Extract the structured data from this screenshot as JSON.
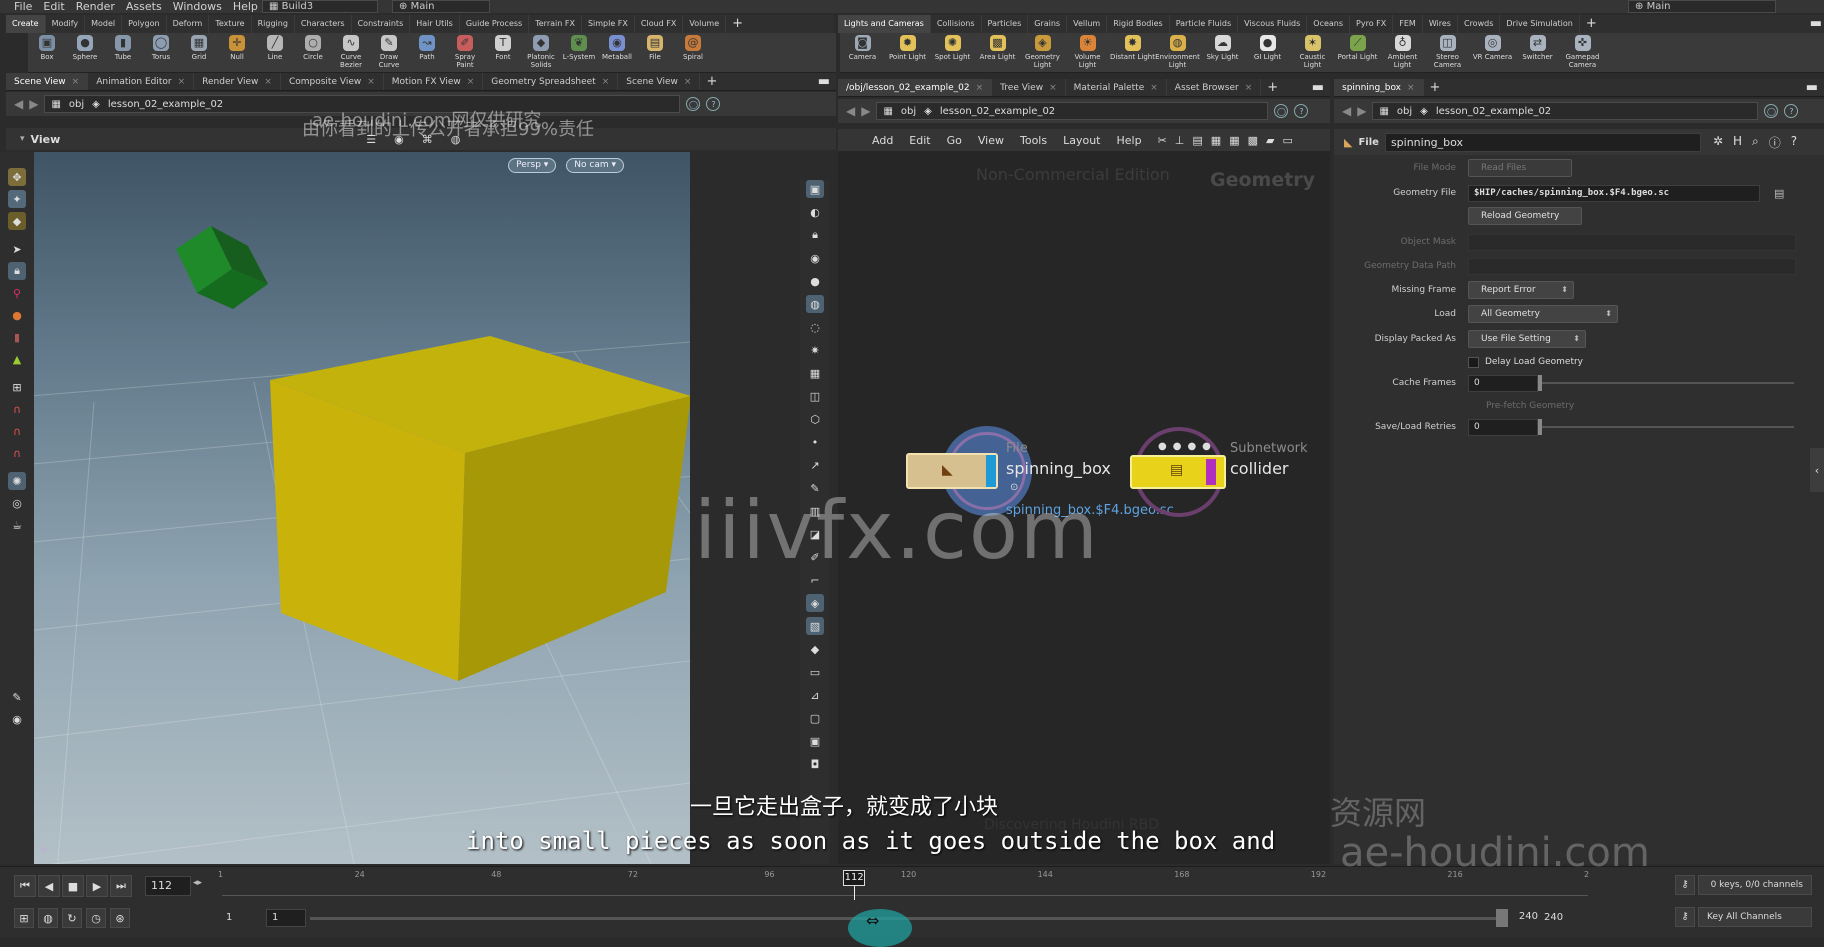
{
  "menu": [
    "File",
    "Edit",
    "Render",
    "Assets",
    "Windows",
    "Help"
  ],
  "desktop": "Build3",
  "context": "Main",
  "context_right": "Main",
  "shelf_left": {
    "tabs": [
      "Create",
      "Modify",
      "Model",
      "Polygon",
      "Deform",
      "Texture",
      "Rigging",
      "Characters",
      "Constraints",
      "Hair Utils",
      "Guide Process",
      "Terrain FX",
      "Simple FX",
      "Cloud FX",
      "Volume"
    ],
    "tools": [
      {
        "label": "Box",
        "color": "#7c8fa5",
        "glyph": "▣"
      },
      {
        "label": "Sphere",
        "color": "#95a6b8",
        "glyph": "●"
      },
      {
        "label": "Tube",
        "color": "#8797aa",
        "glyph": "▮"
      },
      {
        "label": "Torus",
        "color": "#8d9db0",
        "glyph": "◯"
      },
      {
        "label": "Grid",
        "color": "#9aa5b2",
        "glyph": "▦"
      },
      {
        "label": "Null",
        "color": "#c89238",
        "glyph": "✛"
      },
      {
        "label": "Line",
        "color": "#b7b7b7",
        "glyph": "╱"
      },
      {
        "label": "Circle",
        "color": "#adadad",
        "glyph": "○"
      },
      {
        "label": "Curve Bezier",
        "color": "#c7c7c7",
        "glyph": "∿"
      },
      {
        "label": "Draw Curve",
        "color": "#c7c7c7",
        "glyph": "✎"
      },
      {
        "label": "Path",
        "color": "#6f93c5",
        "glyph": "↝"
      },
      {
        "label": "Spray Paint",
        "color": "#c85d5d",
        "glyph": "✐"
      },
      {
        "label": "Font",
        "color": "#cfcfcf",
        "glyph": "T"
      },
      {
        "label": "Platonic Solids",
        "color": "#8f9bb0",
        "glyph": "◆"
      },
      {
        "label": "L-System",
        "color": "#5f8e4e",
        "glyph": "❦"
      },
      {
        "label": "Metaball",
        "color": "#7a8fd0",
        "glyph": "◉"
      },
      {
        "label": "File",
        "color": "#d8b56c",
        "glyph": "▤"
      },
      {
        "label": "Spiral",
        "color": "#c67a3b",
        "glyph": "@"
      }
    ]
  },
  "shelf_right": {
    "tabs": [
      "Lights and Cameras",
      "Collisions",
      "Particles",
      "Grains",
      "Vellum",
      "Rigid Bodies",
      "Particle Fluids",
      "Viscous Fluids",
      "Oceans",
      "Pyro FX",
      "FEM",
      "Wires",
      "Crowds",
      "Drive Simulation"
    ],
    "tools": [
      {
        "label": "Camera",
        "color": "#9ea9b5",
        "glyph": "◙"
      },
      {
        "label": "Point Light",
        "color": "#e2c15a",
        "glyph": "✹"
      },
      {
        "label": "Spot Light",
        "color": "#e2c15a",
        "glyph": "✺"
      },
      {
        "label": "Area Light",
        "color": "#e2c15a",
        "glyph": "▩"
      },
      {
        "label": "Geometry Light",
        "color": "#c99a3c",
        "glyph": "◈"
      },
      {
        "label": "Volume Light",
        "color": "#d98438",
        "glyph": "☀"
      },
      {
        "label": "Distant Light",
        "color": "#e2c15a",
        "glyph": "✸"
      },
      {
        "label": "Environment Light",
        "color": "#d9b04a",
        "glyph": "◍"
      },
      {
        "label": "Sky Light",
        "color": "#d8d8d8",
        "glyph": "☁"
      },
      {
        "label": "GI Light",
        "color": "#e7e7e7",
        "glyph": "●"
      },
      {
        "label": "Caustic Light",
        "color": "#d8c36a",
        "glyph": "✶"
      },
      {
        "label": "Portal Light",
        "color": "#7ba34b",
        "glyph": "⟋"
      },
      {
        "label": "Ambient Light",
        "color": "#d8d8d8",
        "glyph": "♁"
      },
      {
        "label": "Stereo Camera",
        "color": "#a9b3bf",
        "glyph": "◫"
      },
      {
        "label": "VR Camera",
        "color": "#a9b3bf",
        "glyph": "◎"
      },
      {
        "label": "Switcher",
        "color": "#a9b3bf",
        "glyph": "⇄"
      },
      {
        "label": "Gamepad Camera",
        "color": "#a9b3bf",
        "glyph": "✜"
      }
    ]
  },
  "left_pane": {
    "tabs": [
      "Scene View",
      "Animation Editor",
      "Render View",
      "Composite View",
      "Motion FX View",
      "Geometry Spreadsheet",
      "Scene View"
    ],
    "path": [
      "obj",
      "lesson_02_example_02"
    ],
    "view_label": "View",
    "persp": "Persp ▾",
    "cam": "No cam ▾"
  },
  "mid_pane": {
    "tabs": [
      "/obj/lesson_02_example_02",
      "Tree View",
      "Material Palette",
      "Asset Browser"
    ],
    "path": [
      "obj",
      "lesson_02_example_02"
    ],
    "menus": [
      "Add",
      "Edit",
      "Go",
      "View",
      "Tools",
      "Layout",
      "Help"
    ],
    "edition": "Non-Commercial Edition",
    "context_label": "Geometry",
    "nodes": [
      {
        "type": "File",
        "name": "spinning_box",
        "sub": "spinning_box.$F4.bgeo.sc"
      },
      {
        "type": "Subnetwork",
        "name": "collider"
      }
    ],
    "bg_text": "Discovering Houdini RBD"
  },
  "right_pane": {
    "tab": "spinning_box",
    "path": [
      "obj",
      "lesson_02_example_02"
    ],
    "node_label": "File",
    "node_name": "spinning_box",
    "params": [
      {
        "label": "File Mode",
        "value": "Read Files",
        "kind": "dd-dim"
      },
      {
        "label": "Geometry File",
        "value": "$HIP/caches/spinning_box.$F4.bgeo.sc",
        "kind": "field"
      },
      {
        "label": "",
        "value": "Reload Geometry",
        "kind": "btn"
      },
      {
        "label": "Object Mask",
        "value": "",
        "kind": "dim-field"
      },
      {
        "label": "Geometry Data Path",
        "value": "",
        "kind": "dim-field"
      },
      {
        "label": "Missing Frame",
        "value": "Report Error",
        "kind": "dd"
      },
      {
        "label": "Load",
        "value": "All Geometry",
        "kind": "dd"
      },
      {
        "label": "Display Packed As",
        "value": "Use File Setting",
        "kind": "dd"
      },
      {
        "label": "",
        "value": "Delay Load Geometry",
        "kind": "check"
      },
      {
        "label": "Cache Frames",
        "value": "0",
        "kind": "slider"
      },
      {
        "label": "",
        "value": "Pre-fetch Geometry",
        "kind": "dim-text"
      },
      {
        "label": "Save/Load Retries",
        "value": "0",
        "kind": "slider"
      }
    ]
  },
  "timeline": {
    "frame": "112",
    "start": "1",
    "start2": "1",
    "end": "240",
    "end2": "240",
    "ticks": [
      "1",
      "24",
      "48",
      "72",
      "96",
      "120",
      "144",
      "168",
      "192",
      "216",
      "2"
    ],
    "keys": "0 keys, 0/0 channels",
    "key_all": "Key All Channels",
    "current_fraction": 0.4628
  },
  "watermarks": {
    "top1": "ae-houdini.com网仅供研究",
    "top2": "由你看到的上传公开者承担99%责任",
    "center": "iiivfx.com",
    "br1": "资源网",
    "br2": "ae-houdini.com"
  },
  "subtitles": {
    "zh": "一旦它走出盒子，就变成了小块",
    "en": "into small pieces as soon as it goes outside the box and"
  }
}
